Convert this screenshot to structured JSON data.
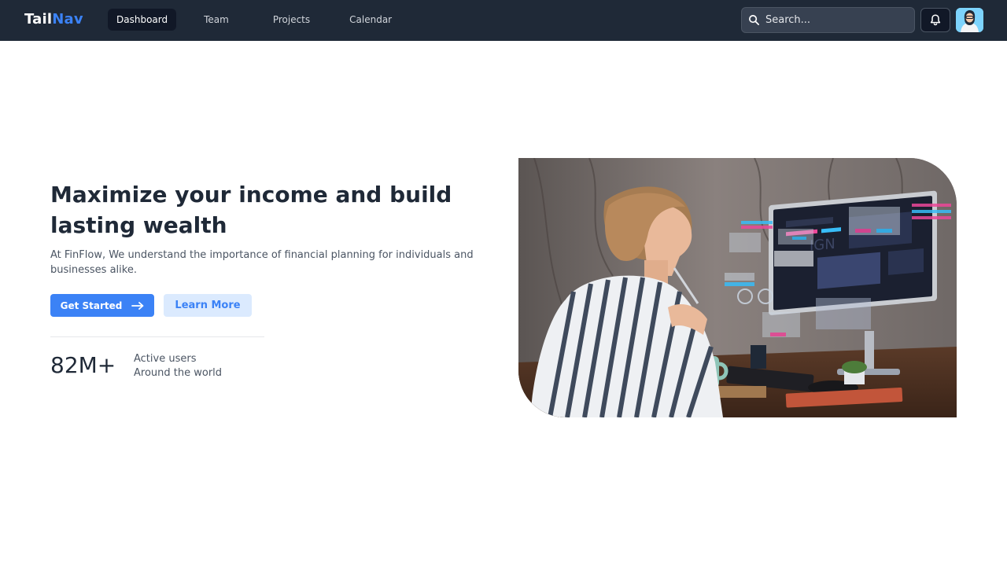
{
  "nav": {
    "brand_part1": "Tail",
    "brand_part2": "Nav",
    "links": [
      {
        "label": "Dashboard",
        "active": true
      },
      {
        "label": "Team",
        "active": false
      },
      {
        "label": "Projects",
        "active": false
      },
      {
        "label": "Calendar",
        "active": false
      }
    ],
    "search_placeholder": "Search...",
    "icons": {
      "search": "search-icon",
      "notifications": "bell-icon",
      "avatar": "user-avatar"
    }
  },
  "hero": {
    "title": "Maximize your income and build lasting wealth",
    "description": "At FinFlow, We understand the importance of financial planning for individuals and businesses alike.",
    "primary_button": "Get Started",
    "secondary_button": "Learn More",
    "stat": {
      "value": "82M+",
      "line1": "Active users",
      "line2": "Around the world"
    }
  },
  "colors": {
    "nav_bg": "#1f2937",
    "accent": "#3b82f6",
    "accent_light": "#dbeafe"
  }
}
